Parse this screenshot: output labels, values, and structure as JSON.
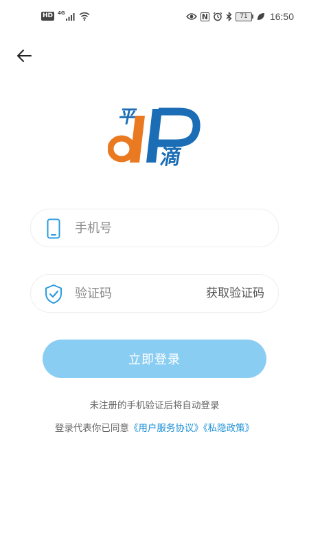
{
  "status_bar": {
    "hd_label": "HD",
    "network_type": "4G",
    "nfc_label": "N",
    "battery_level": "71",
    "time": "16:50"
  },
  "header": {
    "back_icon": "arrow-left-icon"
  },
  "logo": {
    "top_char": "平",
    "bottom_char": "滴",
    "colors": {
      "orange": "#ea7a22",
      "blue": "#1b6db5"
    }
  },
  "phone_field": {
    "icon": "phone-icon",
    "placeholder": "手机号",
    "value": ""
  },
  "code_field": {
    "icon": "shield-check-icon",
    "placeholder": "验证码",
    "value": "",
    "get_code_label": "获取验证码"
  },
  "login_button": {
    "label": "立即登录"
  },
  "notes": {
    "auto_register": "未注册的手机验证后将自动登录",
    "agree_prefix": "登录代表你已同意",
    "user_agreement": "《用户服务协议》",
    "privacy_policy": "《私隐政策》"
  },
  "colors": {
    "accent": "#1c8fd6",
    "login_button_bg": "#8acdf2",
    "icon_blue": "#2a9be0"
  }
}
